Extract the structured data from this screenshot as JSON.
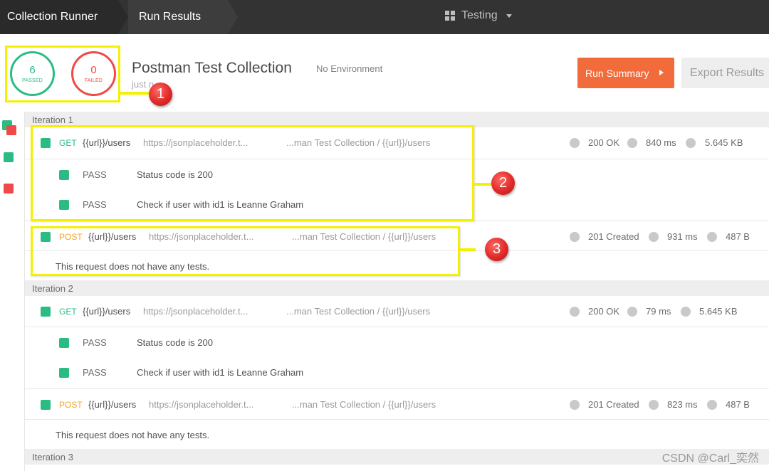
{
  "topbar": {
    "crumb_collection_runner": "Collection Runner",
    "crumb_run_results": "Run Results",
    "workspace": "Testing"
  },
  "summary": {
    "passed_count": "6",
    "passed_label": "PASSED",
    "failed_count": "0",
    "failed_label": "FAILED",
    "collection_title": "Postman Test Collection",
    "environment": "No Environment",
    "time": "just n",
    "run_summary_label": "Run Summary",
    "export_label": "Export Results"
  },
  "markers": [
    "1",
    "2",
    "3"
  ],
  "iterations": [
    {
      "label": "Iteration 1",
      "requests": [
        {
          "method": "GET",
          "name": "{{url}}/users",
          "url": "https://jsonplaceholder.t...",
          "path": "...man Test Collection / {{url}}/users",
          "status": "200 OK",
          "time": "840 ms",
          "size": "5.645 KB",
          "tests": [
            {
              "result": "PASS",
              "name": "Status code is 200"
            },
            {
              "result": "PASS",
              "name": "Check if user with id1 is Leanne Graham"
            }
          ]
        },
        {
          "method": "POST",
          "name": "{{url}}/users",
          "url": "https://jsonplaceholder.t...",
          "path": "...man Test Collection / {{url}}/users",
          "status": "201 Created",
          "time": "931 ms",
          "size": "487 B",
          "no_tests": "This request does not have any tests."
        }
      ]
    },
    {
      "label": "Iteration 2",
      "requests": [
        {
          "method": "GET",
          "name": "{{url}}/users",
          "url": "https://jsonplaceholder.t...",
          "path": "...man Test Collection / {{url}}/users",
          "status": "200 OK",
          "time": "79 ms",
          "size": "5.645 KB",
          "tests": [
            {
              "result": "PASS",
              "name": "Status code is 200"
            },
            {
              "result": "PASS",
              "name": "Check if user with id1 is Leanne Graham"
            }
          ]
        },
        {
          "method": "POST",
          "name": "{{url}}/users",
          "url": "https://jsonplaceholder.t...",
          "path": "...man Test Collection / {{url}}/users",
          "status": "201 Created",
          "time": "823 ms",
          "size": "487 B",
          "no_tests": "This request does not have any tests."
        }
      ]
    },
    {
      "label": "Iteration 3"
    }
  ],
  "watermark": "CSDN @Carl_奕然",
  "colors": {
    "topbar": "#333333",
    "pass_green": "#2bbc84",
    "fail_red": "#ef4a49",
    "post_orange": "#f5a623",
    "run_summary_orange": "#f26b3a",
    "highlight_yellow": "#f4f000"
  }
}
